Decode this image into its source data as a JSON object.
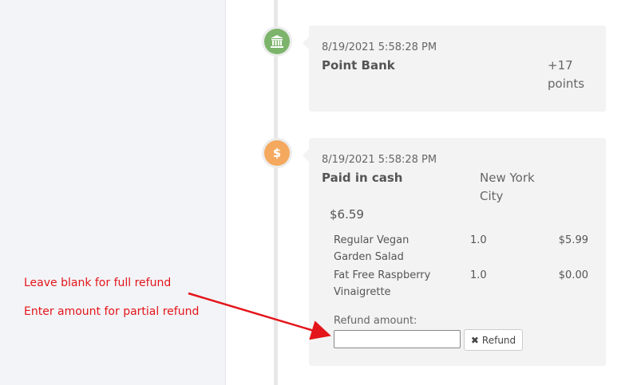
{
  "timeline": {
    "point_bank": {
      "timestamp": "8/19/2021 5:58:28 PM",
      "title": "Point Bank",
      "points_line1": "+17",
      "points_line2": "points",
      "icon": "bank-icon"
    },
    "cash": {
      "timestamp": "8/19/2021 5:58:28 PM",
      "title": "Paid in cash",
      "location_line1": "New York",
      "location_line2": "City",
      "amount": "$6.59",
      "icon": "dollar-icon",
      "icon_glyph": "$",
      "items": [
        {
          "name_line1": "Regular Vegan",
          "name_line2": "Garden Salad",
          "qty": "1.0",
          "price": "$5.99"
        },
        {
          "name_line1": "Fat Free Raspberry",
          "name_line2": "Vinaigrette",
          "qty": "1.0",
          "price": "$0.00"
        }
      ],
      "refund_label": "Refund amount:",
      "refund_value": "",
      "refund_button": "Refund"
    }
  },
  "annotations": {
    "line1": "Leave blank for full refund",
    "line2": "Enter amount for partial refund",
    "color": "#e3151a"
  },
  "colors": {
    "bank_icon_bg": "#7cb46b",
    "cash_icon_bg": "#f4a95e",
    "card_bg": "#f3f3f3",
    "left_panel_bg": "#f3f4f7"
  }
}
